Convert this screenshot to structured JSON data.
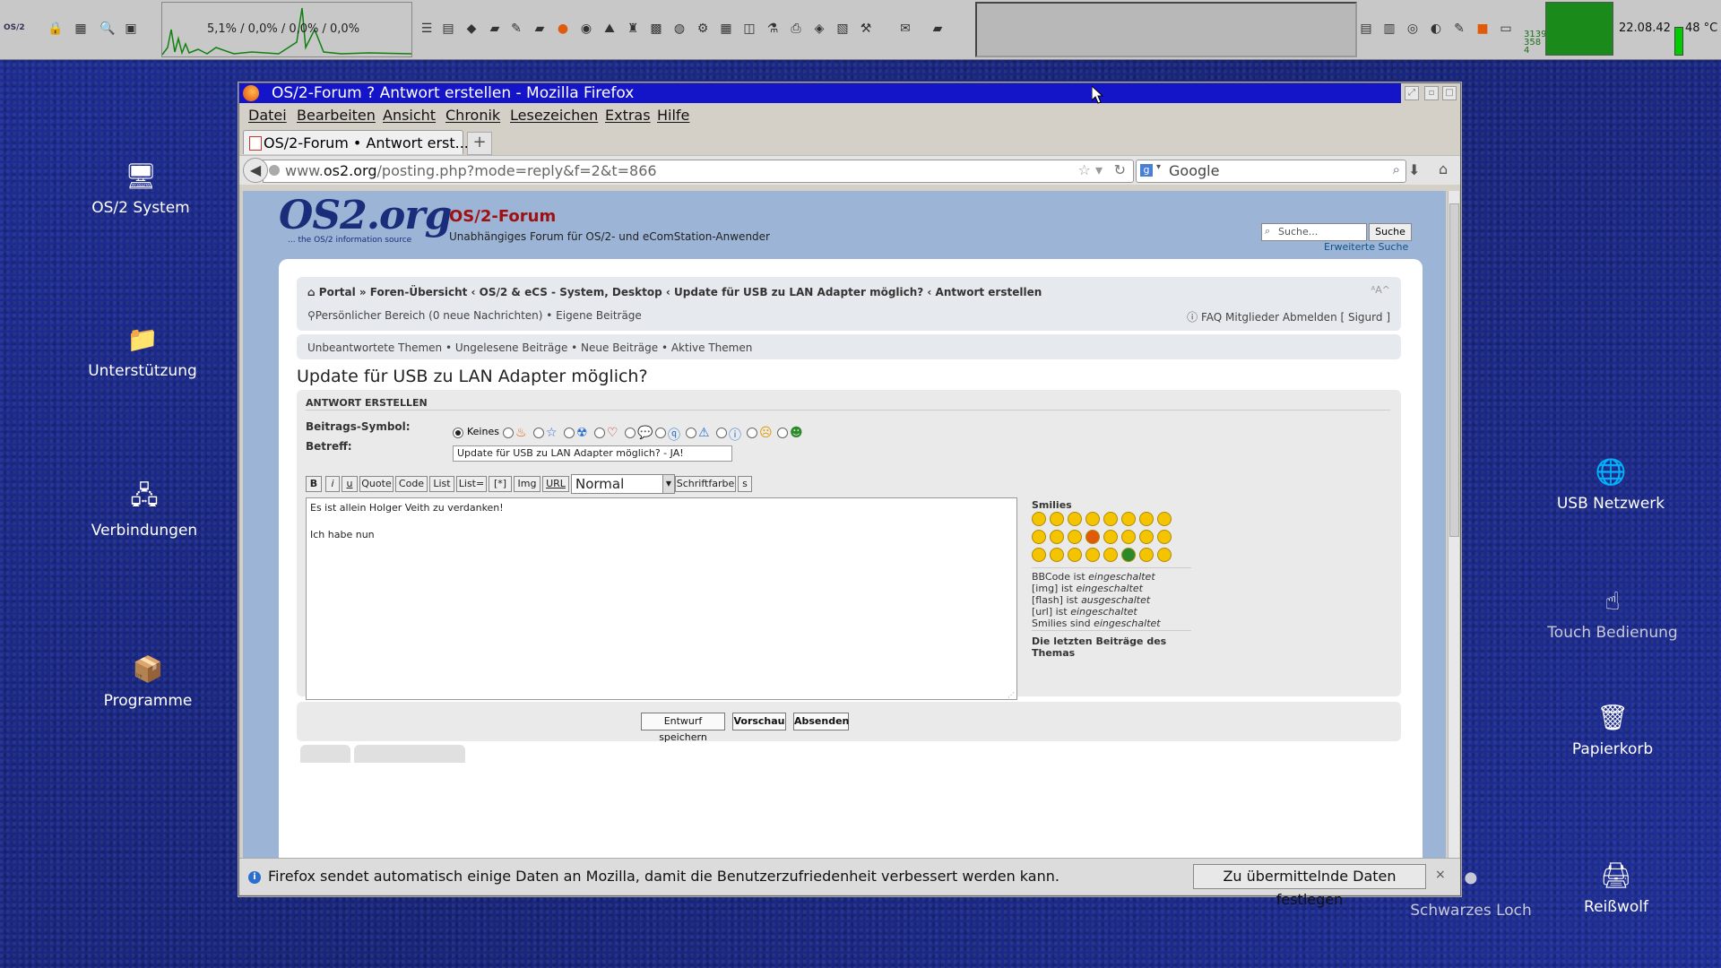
{
  "panel": {
    "logo": "OS/2",
    "cpu_text": "5,1% / 0,0% / 0,0% / 0,0%",
    "clock": "22.08.42",
    "temperature": "48 °C",
    "mem_nums": [
      "3139",
      "358",
      "4"
    ]
  },
  "desktop_icons": {
    "os2_system": "OS/2 System",
    "support": "Unterstützung",
    "connections": "Verbindungen",
    "programs": "Programme",
    "usb_network": "USB Netzwerk",
    "touch": "Touch Bedienung",
    "trash": "Papierkorb",
    "shredder": "Reißwolf",
    "black_hole": "Schwarzes Loch"
  },
  "window": {
    "title": "OS/2-Forum ? Antwort erstellen - Mozilla Firefox",
    "menu": [
      "Datei",
      "Bearbeiten",
      "Ansicht",
      "Chronik",
      "Lesezeichen",
      "Extras",
      "Hilfe"
    ],
    "tab_title": "OS/2-Forum • Antwort erst...",
    "new_tab": "+",
    "url_prefix": "www.",
    "url_domain": "os2.org",
    "url_path": "/posting.php?mode=reply&f=2&t=866",
    "search_engine": "Google"
  },
  "site": {
    "logo": "OS2.org",
    "logo_sub": "... the OS/2 information source",
    "title": "OS/2-Forum",
    "description": "Unabhängiges Forum für OS/2- und eComStation-Anwender",
    "search_placeholder": "Suche...",
    "search_button": "Suche",
    "advanced_search": "Erweiterte Suche",
    "breadcrumbs": "Portal » Foren-Übersicht ‹ OS/2 & eCS - System, Desktop ‹ Update für USB zu LAN Adapter möglich? ‹ Antwort erstellen",
    "font_size_toggle": "ᴬA^",
    "ucp": "Persönlicher Bereich (0 neue Nachrichten) • Eigene Beiträge",
    "ucp_right": "FAQ   Mitglieder   Abmelden [ Sigurd ]",
    "quicklinks": "Unbeantwortete Themen • Ungelesene Beiträge • Neue Beiträge • Aktive Themen",
    "topic_title": "Update für USB zu LAN Adapter möglich?"
  },
  "form": {
    "header": "ANTWORT ERSTELLEN",
    "icon_label": "Beitrags-Symbol:",
    "icon_none": "Keines",
    "subject_label": "Betreff:",
    "subject_value": "Update für USB zu LAN Adapter möglich? - JA!",
    "bbcode_buttons": [
      "B",
      "i",
      "u",
      "Quote",
      "Code",
      "List",
      "List=",
      "[*]",
      "Img",
      "URL"
    ],
    "font_size": "Normal",
    "font_color": "Schriftfarbe",
    "s_button": "s",
    "message_lines": [
      "Es ist allein Holger Veith zu verdanken!",
      "",
      "Ich habe nun"
    ],
    "smilies_title": "Smilies",
    "bbcode_status": [
      {
        "label": "BBCode ist ",
        "value": "eingeschaltet"
      },
      {
        "label": "[img] ist ",
        "value": "eingeschaltet"
      },
      {
        "label": "[flash] ist ",
        "value": "ausgeschaltet"
      },
      {
        "label": "[url] ist ",
        "value": "eingeschaltet"
      },
      {
        "label": "Smilies sind ",
        "value": "eingeschaltet"
      }
    ],
    "last_posts": "Die letzten Beiträge des Themas",
    "save_draft": "Entwurf speichern",
    "preview": "Vorschau",
    "submit": "Absenden"
  },
  "notification": {
    "message": "Firefox sendet automatisch einige Daten an Mozilla, damit die Benutzerzufriedenheit verbessert werden kann.",
    "button": "Zu übermittelnde Daten festlegen",
    "close": "×"
  }
}
